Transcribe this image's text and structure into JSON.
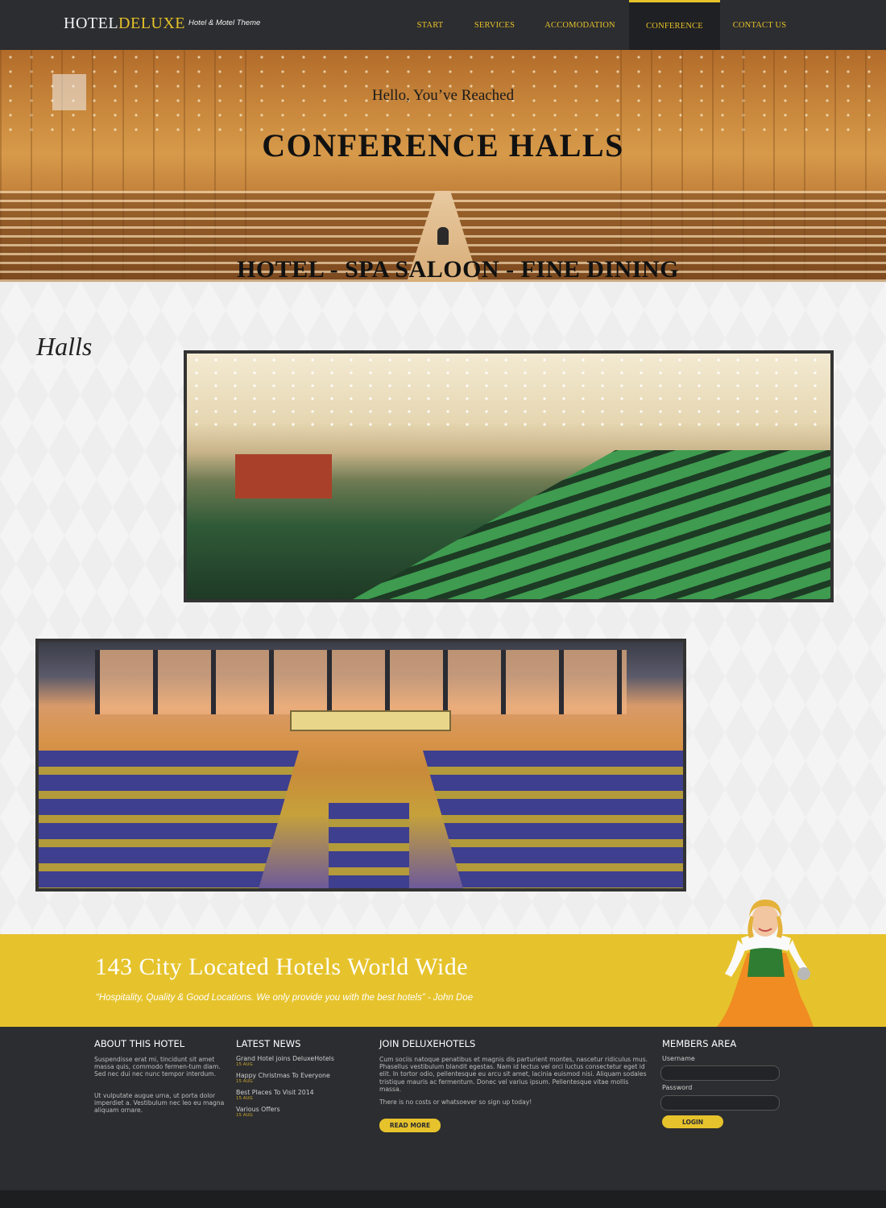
{
  "header": {
    "logo_part1": "HOTEL",
    "logo_part2": "DELUXE",
    "logo_tagline": "Hotel & Motel Theme",
    "nav": [
      {
        "label": "START",
        "active": false
      },
      {
        "label": "SERVICES",
        "active": false
      },
      {
        "label": "ACCOMODATION",
        "active": false
      },
      {
        "label": "CONFERENCE",
        "active": true
      },
      {
        "label": "CONTACT US",
        "active": false
      }
    ]
  },
  "hero": {
    "greeting": "Hello, You’ve Reached",
    "title": "CONFERENCE HALLS",
    "subtitle": "HOTEL - SPA SALOON - FINE DINING"
  },
  "main": {
    "section_title": "Halls"
  },
  "banner": {
    "title": "143 City  Located Hotels World Wide",
    "quote": "“Hospitality, Quality & Good Locations. We only provide you with the best hotels” - John Doe"
  },
  "footer": {
    "about": {
      "title": "ABOUT THIS HOTEL",
      "paragraph1": "Suspendisse erat mi, tincidunt sit amet massa quis, commodo fermen-tum diam. Sed nec dui nec nunc tempor interdum.",
      "paragraph2": "Ut vulputate augue urna, ut porta dolor imperdiet a. Vestibulum nec leo eu magna aliquam ornare."
    },
    "news": {
      "title": "LATEST NEWS",
      "items": [
        {
          "title": "Grand Hotel joins DeluxeHotels",
          "date": "15 AUG"
        },
        {
          "title": "Happy Christmas To Everyone",
          "date": "15 AUG"
        },
        {
          "title": "Best Places To Visit 2014",
          "date": "15 AUG"
        },
        {
          "title": "Various Offers",
          "date": "15 AUG"
        }
      ]
    },
    "join": {
      "title": "JOIN DELUXEHOTELS",
      "paragraph1": "Cum sociis natoque penatibus et magnis dis parturient montes, nascetur ridiculus mus. Phasellus vestibulum blandit egestas. Nam id lectus vel orci luctus consectetur eget id elit. In tortor odio, pellentesque eu arcu sit amet, lacinia euismod nisi. Aliquam sodales tristique mauris ac fermentum. Donec vel varius ipsum. Pellentesque vitae mollis massa.",
      "paragraph2": "There is no costs or whatsoever so sign up today!",
      "button_label": "READ MORE"
    },
    "members": {
      "title": "MEMBERS AREA",
      "username_label": "Username",
      "username_value": "",
      "password_label": "Password",
      "password_value": "",
      "login_label": "LOGIN"
    }
  },
  "colors": {
    "accent": "#e6c32c",
    "header_bg": "#2c2d30",
    "footer_bg": "#2c2d30"
  }
}
